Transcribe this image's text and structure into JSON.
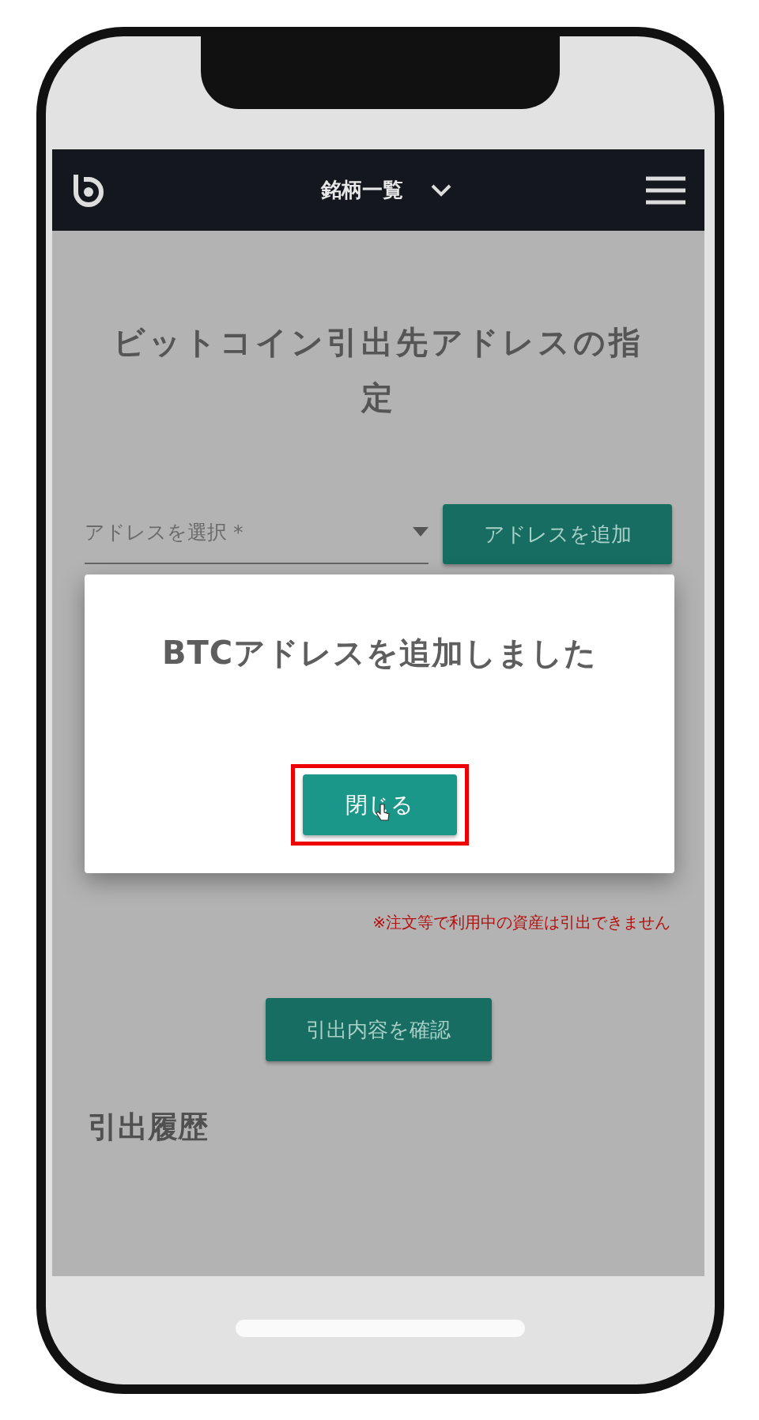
{
  "header": {
    "menu_label": "銘柄一覧"
  },
  "title": "ビットコイン引出先アドレスの指定",
  "address_select": {
    "placeholder": "アドレスを選択 *"
  },
  "add_address_button": "アドレスを追加",
  "note": "※注文等で利用中の資産は引出できません",
  "confirm_button": "引出内容を確認",
  "history_heading": "引出履歴",
  "dialog": {
    "message": "BTCアドレスを追加しました",
    "close_button": "閉じる",
    "highlighted": true
  }
}
